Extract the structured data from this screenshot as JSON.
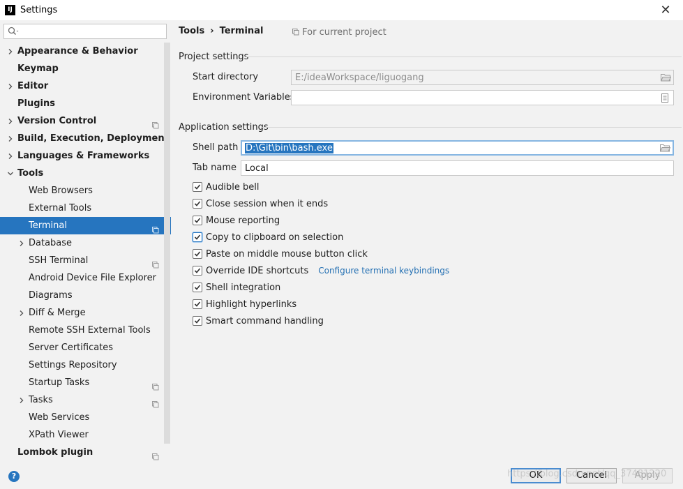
{
  "window": {
    "title": "Settings",
    "close_glyph": "✕"
  },
  "search": {
    "placeholder": "",
    "value": ""
  },
  "sidebar": {
    "items": [
      {
        "label": "Appearance & Behavior",
        "level": 0,
        "arrow": "right",
        "project": false,
        "selected": false
      },
      {
        "label": "Keymap",
        "level": 0,
        "arrow": "none",
        "project": false,
        "selected": false
      },
      {
        "label": "Editor",
        "level": 0,
        "arrow": "right",
        "project": false,
        "selected": false
      },
      {
        "label": "Plugins",
        "level": 0,
        "arrow": "none",
        "project": false,
        "selected": false
      },
      {
        "label": "Version Control",
        "level": 0,
        "arrow": "right",
        "project": true,
        "selected": false
      },
      {
        "label": "Build, Execution, Deployment",
        "level": 0,
        "arrow": "right",
        "project": false,
        "selected": false
      },
      {
        "label": "Languages & Frameworks",
        "level": 0,
        "arrow": "right",
        "project": false,
        "selected": false
      },
      {
        "label": "Tools",
        "level": 0,
        "arrow": "down",
        "project": false,
        "selected": false
      },
      {
        "label": "Web Browsers",
        "level": 1,
        "arrow": "none",
        "project": false,
        "selected": false
      },
      {
        "label": "External Tools",
        "level": 1,
        "arrow": "none",
        "project": false,
        "selected": false
      },
      {
        "label": "Terminal",
        "level": 1,
        "arrow": "none",
        "project": true,
        "selected": true
      },
      {
        "label": "Database",
        "level": 1,
        "arrow": "right",
        "project": false,
        "selected": false
      },
      {
        "label": "SSH Terminal",
        "level": 1,
        "arrow": "none",
        "project": true,
        "selected": false
      },
      {
        "label": "Android Device File Explorer",
        "level": 1,
        "arrow": "none",
        "project": false,
        "selected": false
      },
      {
        "label": "Diagrams",
        "level": 1,
        "arrow": "none",
        "project": false,
        "selected": false
      },
      {
        "label": "Diff & Merge",
        "level": 1,
        "arrow": "right",
        "project": false,
        "selected": false
      },
      {
        "label": "Remote SSH External Tools",
        "level": 1,
        "arrow": "none",
        "project": false,
        "selected": false
      },
      {
        "label": "Server Certificates",
        "level": 1,
        "arrow": "none",
        "project": false,
        "selected": false
      },
      {
        "label": "Settings Repository",
        "level": 1,
        "arrow": "none",
        "project": false,
        "selected": false
      },
      {
        "label": "Startup Tasks",
        "level": 1,
        "arrow": "none",
        "project": true,
        "selected": false
      },
      {
        "label": "Tasks",
        "level": 1,
        "arrow": "right",
        "project": true,
        "selected": false
      },
      {
        "label": "Web Services",
        "level": 1,
        "arrow": "none",
        "project": false,
        "selected": false
      },
      {
        "label": "XPath Viewer",
        "level": 1,
        "arrow": "none",
        "project": false,
        "selected": false
      },
      {
        "label": "Lombok plugin",
        "level": 0,
        "arrow": "none",
        "project": true,
        "selected": false
      }
    ]
  },
  "breadcrumb": {
    "parent": "Tools",
    "separator": "›",
    "current": "Terminal"
  },
  "scope_note": "For current project",
  "project_settings": {
    "title": "Project settings",
    "start_directory": {
      "label": "Start directory",
      "value": "E:/ideaWorkspace/liguogang"
    },
    "env_vars": {
      "label": "Environment Variables",
      "value": ""
    }
  },
  "application_settings": {
    "title": "Application settings",
    "shell_path": {
      "label": "Shell path",
      "value": "D:\\Git\\bin\\bash.exe"
    },
    "tab_name": {
      "label": "Tab name",
      "value": "Local"
    },
    "checkboxes": [
      {
        "label": "Audible bell",
        "checked": true
      },
      {
        "label": "Close session when it ends",
        "checked": true
      },
      {
        "label": "Mouse reporting",
        "checked": true
      },
      {
        "label": "Copy to clipboard on selection",
        "checked": true,
        "focused": true
      },
      {
        "label": "Paste on middle mouse button click",
        "checked": true
      },
      {
        "label": "Override IDE shortcuts",
        "checked": true,
        "link": "Configure terminal keybindings"
      },
      {
        "label": "Shell integration",
        "checked": true
      },
      {
        "label": "Highlight hyperlinks",
        "checked": true
      },
      {
        "label": "Smart command handling",
        "checked": true
      }
    ]
  },
  "buttons": {
    "help": "?",
    "ok": "OK",
    "cancel": "Cancel",
    "apply": "Apply"
  },
  "watermark": "https://blog.csdn.net/qq_37481220",
  "colors": {
    "selection": "#2675bf",
    "link": "#2470b3",
    "focus": "#86b6e2"
  }
}
